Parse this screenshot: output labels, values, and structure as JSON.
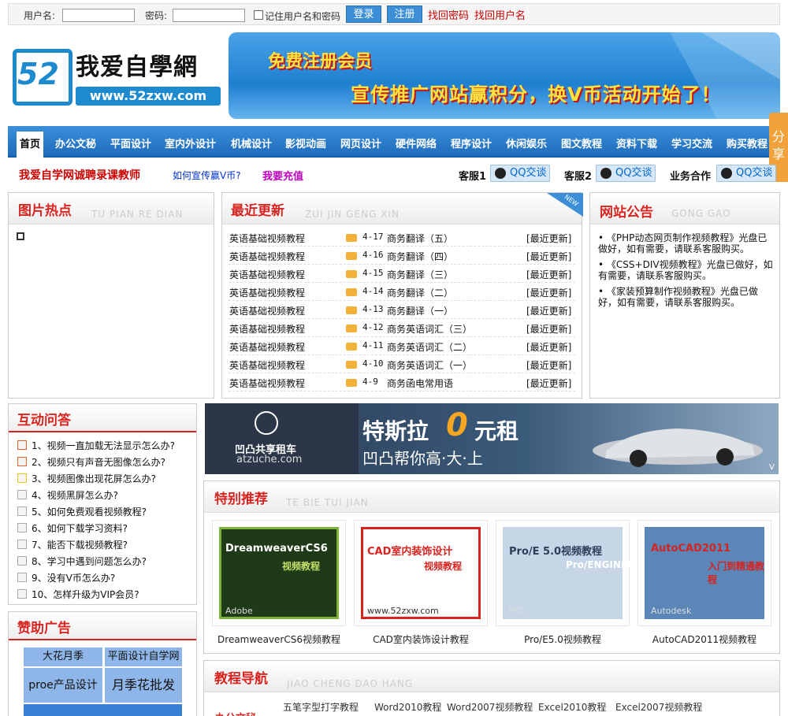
{
  "login": {
    "username_label": "用户名:",
    "password_label": "密码:",
    "remember_label": "记住用户名和密码",
    "login_button": "登录",
    "register_button": "注册",
    "forgot_password": "找回密码",
    "forgot_username": "找回用户名"
  },
  "logo": {
    "badge": "52",
    "title": "我爱自學網",
    "url": "www.52zxw.com"
  },
  "banner": {
    "line1": "免费注册会员",
    "line2": "宣传推广网站赢积分，换V币活动开始了！"
  },
  "nav": {
    "home": "首页",
    "items": [
      "办公文秘",
      "平面设计",
      "室内外设计",
      "机械设计",
      "影视动画",
      "网页设计",
      "硬件网络",
      "程序设计",
      "休闲娱乐",
      "图文教程",
      "资料下载",
      "学习交流",
      "购买教程"
    ]
  },
  "share": "分享",
  "subbar": {
    "recruit": "我爱自学网诚聘录课教师",
    "promote": "如何宣传赢V币?",
    "recharge": "我要充值",
    "kf1": "客服1",
    "kf2": "客服2",
    "biz": "业务合作",
    "qq_label": "QQ交谈"
  },
  "hot": {
    "title": "图片热点",
    "subtitle": "TU PIAN RE DIAN"
  },
  "recent": {
    "title": "最近更新",
    "subtitle": "ZUI JIN GENG XIN",
    "new_badge": "NEW",
    "rows": [
      {
        "category": "英语基础视频教程",
        "date": "4-17",
        "name": "商务翻译（五）",
        "tag": "[最近更新]"
      },
      {
        "category": "英语基础视频教程",
        "date": "4-16",
        "name": "商务翻译（四）",
        "tag": "[最近更新]"
      },
      {
        "category": "英语基础视频教程",
        "date": "4-15",
        "name": "商务翻译（三）",
        "tag": "[最近更新]"
      },
      {
        "category": "英语基础视频教程",
        "date": "4-14",
        "name": "商务翻译（二）",
        "tag": "[最近更新]"
      },
      {
        "category": "英语基础视频教程",
        "date": "4-13",
        "name": "商务翻译（一）",
        "tag": "[最近更新]"
      },
      {
        "category": "英语基础视频教程",
        "date": "4-12",
        "name": "商务英语词汇（三）",
        "tag": "[最近更新]"
      },
      {
        "category": "英语基础视频教程",
        "date": "4-11",
        "name": "商务英语词汇（二）",
        "tag": "[最近更新]"
      },
      {
        "category": "英语基础视频教程",
        "date": "4-10",
        "name": "商务英语词汇（一）",
        "tag": "[最近更新]"
      },
      {
        "category": "英语基础视频教程",
        "date": "4-9",
        "name": "商务函电常用语",
        "tag": "[最近更新]"
      }
    ]
  },
  "notice": {
    "title": "网站公告",
    "subtitle": "GONG GAO",
    "items": [
      "《PHP动态网页制作视频教程》光盘已做好，如有需要，请联系客服购买。",
      "《CSS+DIV视频教程》光盘已做好，如有需要，请联系客服购买。",
      "《家装预算制作视频教程》光盘已做好，如有需要，请联系客服购买。"
    ]
  },
  "qa": {
    "title": "互动问答",
    "items": [
      "1、视频一直加载无法显示怎么办?",
      "2、视频只有声音无图像怎么办?",
      "3、视频图像出现花屏怎么办?",
      "4、视频黑屏怎么办?",
      "5、如何免费观看视频教程?",
      "6、如何下载学习资料?",
      "7、能否下载视频教程?",
      "8、学习中遇到问题怎么办?",
      "9、没有V币怎么办?",
      "10、怎样升级为VIP会员?"
    ],
    "colors": [
      "#e0622a",
      "#e0622a",
      "#e8c31c",
      "#aaa",
      "#aaa",
      "#aaa",
      "#aaa",
      "#aaa",
      "#aaa",
      "#aaa"
    ]
  },
  "sponsor": {
    "title": "赞助广告",
    "cells": [
      "大花月季",
      "平面设计自学网",
      "proe产品设计",
      "月季花批发"
    ]
  },
  "adbanner": {
    "brand": "凹凸共享租车",
    "brand_url": "atzuche.com",
    "headline_a": "特斯拉",
    "headline_b": "0",
    "headline_c": "元租",
    "slogan": "凹凸帮你高·大·上",
    "corner": "V"
  },
  "special": {
    "title": "特别推荐",
    "subtitle": "TE BIE TUI JIAN",
    "cards": [
      {
        "caption": "DreamweaverCS6视频教程",
        "img_title": "DreamweaverCS6",
        "img_sub": "视频教程",
        "img_foot": "Adobe"
      },
      {
        "caption": "CAD室内装饰设计教程",
        "img_title": "CAD室内装饰设计",
        "img_sub": "视频教程",
        "img_foot": "www.52zxw.com"
      },
      {
        "caption": "Pro/E5.0视频教程",
        "img_title": "Pro/E 5.0视频教程",
        "img_sub": "Pro/ENGINEER",
        "img_foot": "PTC"
      },
      {
        "caption": "AutoCAD2011视频教程",
        "img_title": "AutoCAD2011",
        "img_sub": "入门到精通教程",
        "img_foot": "Autodesk"
      }
    ]
  },
  "guide": {
    "title": "教程导航",
    "subtitle": "JIAO CHENG DAO HANG",
    "category": "办公文秘",
    "links": [
      "五笔字型打字教程",
      "Word2010教程",
      "Word2007视频教程",
      "Excel2010教程",
      "Excel2007视频教程"
    ]
  }
}
